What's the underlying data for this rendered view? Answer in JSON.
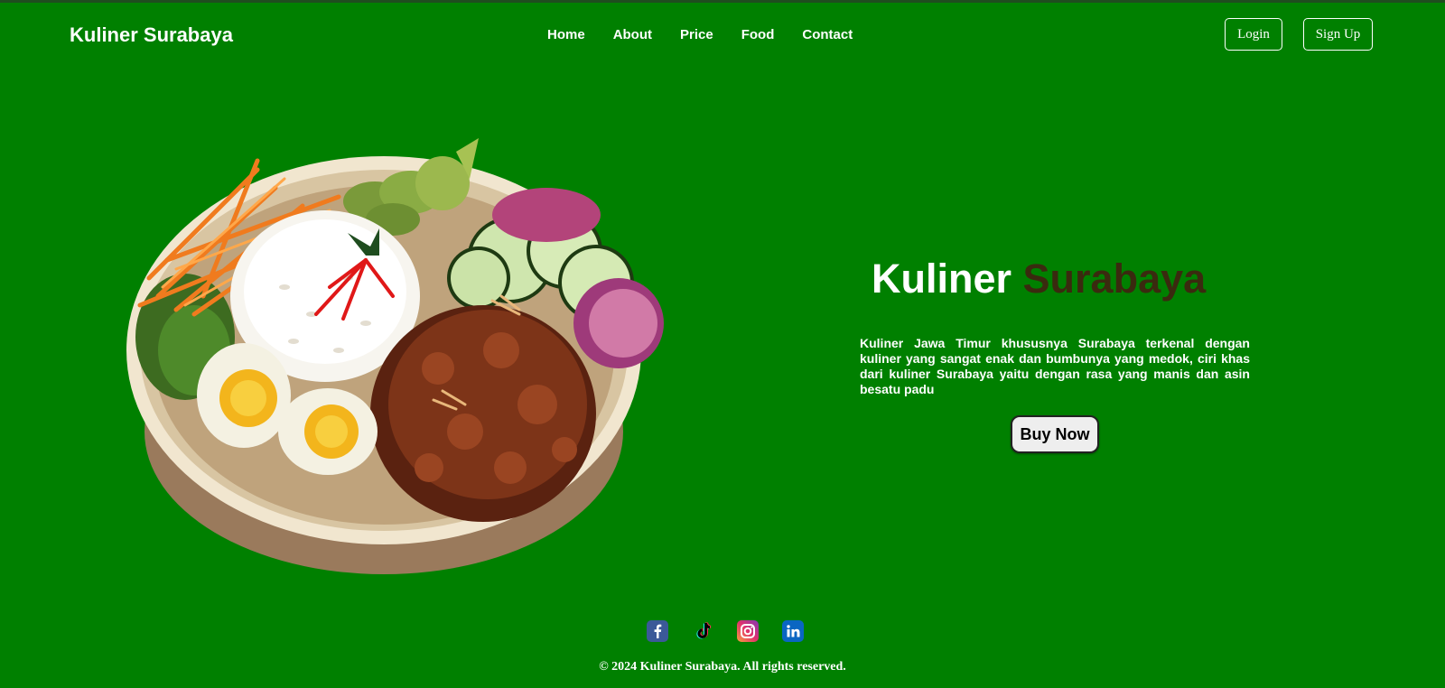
{
  "header": {
    "brand": "Kuliner Surabaya",
    "nav": [
      "Home",
      "About",
      "Price",
      "Food",
      "Contact"
    ],
    "login_label": "Login",
    "signup_label": "Sign Up"
  },
  "hero": {
    "title_part1": "Kuliner",
    "title_part2": "Surabaya",
    "description": "Kuliner Jawa Timur khususnya Surabaya terkenal dengan kuliner yang sangat enak dan bumbunya yang medok, ciri khas dari kuliner Surabaya yaitu dengan rasa yang manis dan asin besatu padu",
    "cta_label": "Buy Now",
    "image_icon": "rice-plate-illustration"
  },
  "footer": {
    "socials": [
      "facebook-icon",
      "tiktok-icon",
      "instagram-icon",
      "linkedin-icon"
    ],
    "copyright": "© 2024 Kuliner Surabaya. All rights reserved."
  },
  "colors": {
    "background": "#008000",
    "accent_text": "#3a2a0f",
    "button_bg": "#eeeeee"
  }
}
